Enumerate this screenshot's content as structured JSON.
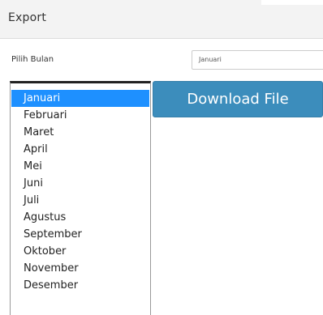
{
  "panel": {
    "title": "Export"
  },
  "form": {
    "month_label": "Pilih Bulan",
    "month_select_value": "Januari"
  },
  "month_list": {
    "selected_index": 0,
    "options": [
      "Januari",
      "Februari",
      "Maret",
      "April",
      "Mei",
      "Juni",
      "Juli",
      "Agustus",
      "September",
      "Oktober",
      "November",
      "Desember"
    ]
  },
  "actions": {
    "download_label": "Download File"
  },
  "colors": {
    "selected_option": "#1e90ff",
    "download_button": "#3c8dbc",
    "header_background": "#f3f3f3"
  }
}
